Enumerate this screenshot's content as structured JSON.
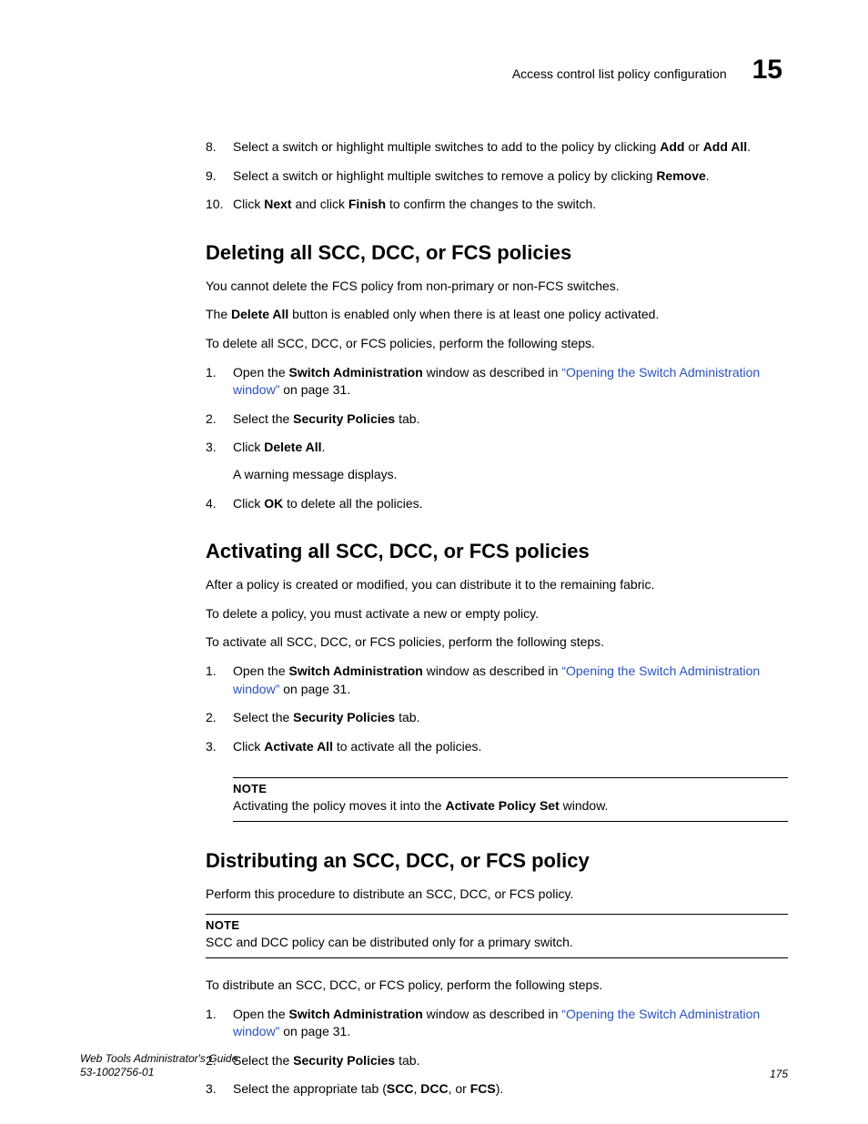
{
  "header": {
    "title": "Access control list policy configuration",
    "chapnum": "15"
  },
  "intro_steps": [
    {
      "pre": "Select a switch or highlight multiple switches to add to the policy by clicking ",
      "b1": "Add",
      "mid": " or ",
      "b2": "Add All",
      "post": "."
    },
    {
      "pre": "Select a switch or highlight multiple switches to remove a policy by clicking ",
      "b1": "Remove",
      "post": "."
    },
    {
      "pre": "Click ",
      "b1": "Next",
      "mid": " and click ",
      "b2": "Finish",
      "post": " to confirm the changes to the switch."
    }
  ],
  "sec1": {
    "heading": "Deleting all SCC, DCC, or FCS policies",
    "p1": "You cannot delete the FCS policy from non-primary or non-FCS switches.",
    "p2_pre": "The ",
    "p2_b": "Delete All",
    "p2_post": " button is enabled only when there is at least one policy activated.",
    "p3": "To delete all SCC, DCC, or FCS policies, perform the following steps.",
    "steps": {
      "s1_pre": "Open the ",
      "s1_b": "Switch Administration",
      "s1_mid": " window as described in ",
      "s1_link": "“Opening the Switch Administration window”",
      "s1_post": " on page 31.",
      "s2_pre": "Select the ",
      "s2_b": "Security Policies",
      "s2_post": " tab.",
      "s3_pre": "Click ",
      "s3_b": "Delete All",
      "s3_post": ".",
      "s3_sub": "A warning message displays.",
      "s4_pre": "Click ",
      "s4_b": "OK",
      "s4_post": " to delete all the policies."
    }
  },
  "sec2": {
    "heading": "Activating all SCC, DCC, or FCS policies",
    "p1": "After a policy is created or modified, you can distribute it to the remaining fabric.",
    "p2": "To delete a policy, you must activate a new or empty policy.",
    "p3": "To activate all SCC, DCC, or FCS policies, perform the following steps.",
    "steps": {
      "s1_pre": "Open the ",
      "s1_b": "Switch Administration",
      "s1_mid": " window as described in ",
      "s1_link": "“Opening the Switch Administration window”",
      "s1_post": " on page 31.",
      "s2_pre": "Select the ",
      "s2_b": "Security Policies",
      "s2_post": " tab.",
      "s3_pre": "Click ",
      "s3_b": "Activate All",
      "s3_post": " to activate all the policies."
    },
    "note_label": "NOTE",
    "note_pre": "Activating the policy moves it into the ",
    "note_b": "Activate Policy Set",
    "note_post": " window."
  },
  "sec3": {
    "heading": "Distributing an SCC, DCC, or FCS policy",
    "p1": "Perform this procedure to distribute an SCC, DCC, or FCS policy.",
    "note_label": "NOTE",
    "note_text": "SCC and DCC policy can be distributed only for a primary switch.",
    "p2": "To distribute an SCC, DCC, or FCS policy, perform the following steps.",
    "steps": {
      "s1_pre": "Open the ",
      "s1_b": "Switch Administration",
      "s1_mid": " window as described in ",
      "s1_link": "“Opening the Switch Administration window”",
      "s1_post": " on page 31.",
      "s2_pre": "Select the ",
      "s2_b": "Security Policies",
      "s2_post": " tab.",
      "s3_pre": "Select the appropriate tab (",
      "s3_b1": "SCC",
      "s3_m1": ", ",
      "s3_b2": "DCC",
      "s3_m2": ", or ",
      "s3_b3": "FCS",
      "s3_post": ")."
    }
  },
  "footer": {
    "line1": "Web Tools Administrator's Guide",
    "line2": "53-1002756-01",
    "pagenum": "175"
  }
}
